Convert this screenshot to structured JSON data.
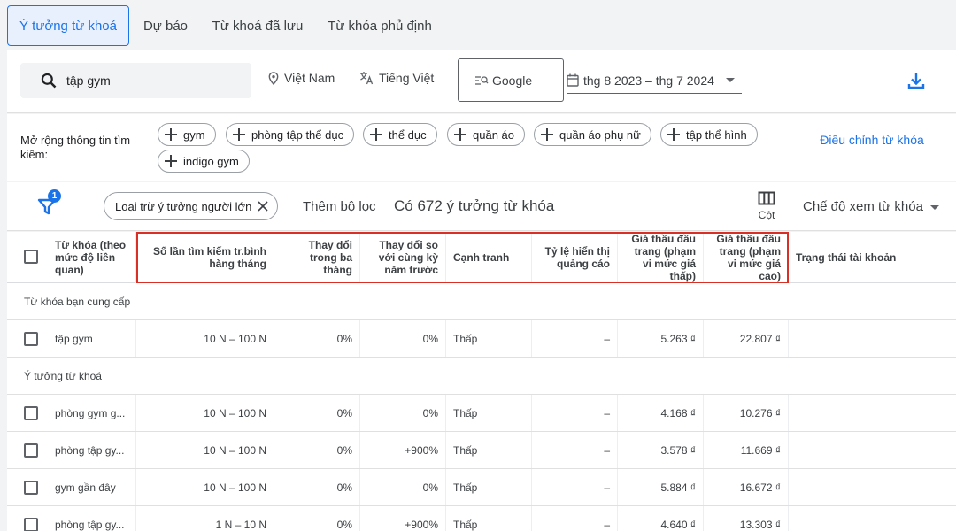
{
  "tabs": [
    {
      "label": "Ý tưởng từ khoá",
      "active": true
    },
    {
      "label": "Dự báo",
      "active": false
    },
    {
      "label": "Từ khoá đã lưu",
      "active": false
    },
    {
      "label": "Từ khóa phủ định",
      "active": false
    }
  ],
  "search": {
    "query": "tập gym",
    "location": "Việt Nam",
    "language": "Tiếng Việt",
    "engine": "Google",
    "date_range": "thg 8 2023 – thg 7 2024"
  },
  "expand": {
    "label": "Mở rộng thông tin tìm kiếm:",
    "chips": [
      "gym",
      "phòng tập thể dục",
      "thể dục",
      "quần áo",
      "quần áo phụ nữ",
      "tập thể hình",
      "indigo gym"
    ],
    "refine_label": "Điều chỉnh từ khóa"
  },
  "toolbar": {
    "filter_badge": "1",
    "exclude_chip": "Loại trừ ý tưởng người lớn",
    "add_filter": "Thêm bộ lọc",
    "count": "Có 672 ý tưởng từ khóa",
    "columns_label": "Cột",
    "view_mode": "Chế độ xem từ khóa"
  },
  "table": {
    "headers": [
      "Từ khóa (theo mức độ liên quan)",
      "Số lần tìm kiếm tr.bình hàng tháng",
      "Thay đổi trong ba tháng",
      "Thay đổi so với cùng kỳ năm trước",
      "Cạnh tranh",
      "Tỷ lệ hiển thị quảng cáo",
      "Giá thầu đầu trang (phạm vi mức giá thấp)",
      "Giá thầu đầu trang (phạm vi mức giá cao)",
      "Trạng thái tài khoản"
    ],
    "section_provided": "Từ khóa bạn cung cấp",
    "section_ideas": "Ý tưởng từ khoá",
    "provided_rows": [
      {
        "keyword": "tập gym",
        "searches": "10 N – 100 N",
        "three_month": "0%",
        "yoy": "0%",
        "competition": "Thấp",
        "impression": "–",
        "bid_low": "5.263 ₫",
        "bid_high": "22.807 ₫"
      }
    ],
    "idea_rows": [
      {
        "keyword": "phòng gym g...",
        "searches": "10 N – 100 N",
        "three_month": "0%",
        "yoy": "0%",
        "competition": "Thấp",
        "impression": "–",
        "bid_low": "4.168 ₫",
        "bid_high": "10.276 ₫"
      },
      {
        "keyword": "phòng tập gy...",
        "searches": "10 N – 100 N",
        "three_month": "0%",
        "yoy": "+900%",
        "competition": "Thấp",
        "impression": "–",
        "bid_low": "3.578 ₫",
        "bid_high": "11.669 ₫"
      },
      {
        "keyword": "gym gần đây",
        "searches": "10 N – 100 N",
        "three_month": "0%",
        "yoy": "0%",
        "competition": "Thấp",
        "impression": "–",
        "bid_low": "5.884 ₫",
        "bid_high": "16.672 ₫"
      },
      {
        "keyword": "phòng tập gy...",
        "searches": "1 N – 10 N",
        "three_month": "0%",
        "yoy": "+900%",
        "competition": "Thấp",
        "impression": "–",
        "bid_low": "4.640 ₫",
        "bid_high": "13.303 ₫"
      }
    ]
  },
  "colors": {
    "accent": "#1a73e8",
    "highlight": "#d93025"
  }
}
